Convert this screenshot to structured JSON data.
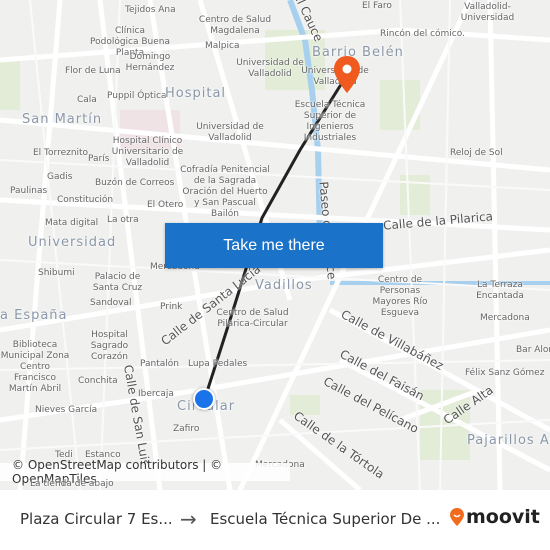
{
  "map": {
    "labels": {
      "tejidos": "Tejidos Ana",
      "cs_magdalena": "Centro de Salud Magdalena",
      "clinica": "Clínica Podológica Buena Planta",
      "malpica": "Malpica",
      "domingo": "Domingo Hernández",
      "flor": "Flor de Luna",
      "cala": "Cala",
      "puppil": "Puppil Óptica",
      "hospital": "Hospital",
      "san_martin": "San Martín",
      "uva1": "Universidad de Valladolid",
      "uva2": "Universidad de Valladolid",
      "uva3": "Universidad de Valladolid",
      "barrio_belen": "Barrio Belén",
      "etsii": "Escuela Técnica Superior de Ingenieros Industriales",
      "rincon": "Rincón del cómico.",
      "valladolid_univ": "Valladolid-Universidad",
      "el_faro": "El Faro",
      "hospital_clinico": "Hospital Clínico Universitario de Valladolid",
      "torreznito": "El Torreznito",
      "paris": "París",
      "gadis": "Gadis",
      "buzon": "Buzón de Correos",
      "paulinas": "Paulinas",
      "constitucion": "Constitución",
      "cofradia": "Cofradía Penitencial de la Sagrada Oración del Huerto y San Pascual Bailón",
      "el_otero": "El Otero",
      "reloj": "Reloj de Sol",
      "mata": "Mata digital",
      "la_otra": "La otra",
      "universidad": "Universidad",
      "shibumi": "Shibumi",
      "palacio": "Palacio de Santa Cruz",
      "sandoval": "Sandoval",
      "prink": "Prink",
      "vadillos": "Vadillos",
      "cs_pilarica": "Centro de Salud Pilarica-Circular",
      "espana": "a España",
      "hospital_sagrado": "Hospital Sagrado Corazón",
      "biblioteca": "Biblioteca Municipal Zona Centro Francisco Martín Abril",
      "pantalon": "Pantalón",
      "lupa": "Lupa Pedales",
      "conchita": "Conchita",
      "ibercaja": "Ibercaja",
      "circular": "Circular",
      "nieves": "Nieves García",
      "zafiro": "Zafiro",
      "tedi": "Tedi",
      "estanco": "Estanco",
      "mercadona1": "Mercadona",
      "mercadona2": "Mercadona",
      "centro_mayores": "Centro de Personas Mayores Río Esgueva",
      "terraza": "La Terraza Encantada",
      "bar": "Bar Alon",
      "felix": "Félix Sanz Gómez",
      "pajarillos": "Pajarillos Al",
      "tienda": "La tienda de abajo"
    },
    "streets": {
      "cauce": "el Cauce",
      "paseo": "Paseo del Cauce",
      "pilarica": "Calle de la Pilarica",
      "santa_lucia": "Calle de Santa Lucía",
      "villabanez": "Calle de Villabáñez",
      "faisan": "Calle del Faisán",
      "pelicano": "Calle del Pelícano",
      "tortola": "Calle de la Tórtola",
      "alta": "Calle Alta",
      "san_luis": "Calle de San Luis"
    },
    "route_color": "#222222",
    "origin_color": "#1a73e8",
    "destination_pin_color": "#f05a1e",
    "destination_icon": "map-pin-icon",
    "origin_icon": "origin-dot-icon"
  },
  "cta": {
    "label": "Take me there",
    "color": "#1a73c8"
  },
  "attribution": "© OpenStreetMap contributors | © OpenMapTiles",
  "footer": {
    "from": "Plaza Circular 7 Es...",
    "arrow": "→",
    "to": "Escuela Técnica Superior De ...",
    "logo": "moovit",
    "logo_color": "#f26b1d"
  }
}
